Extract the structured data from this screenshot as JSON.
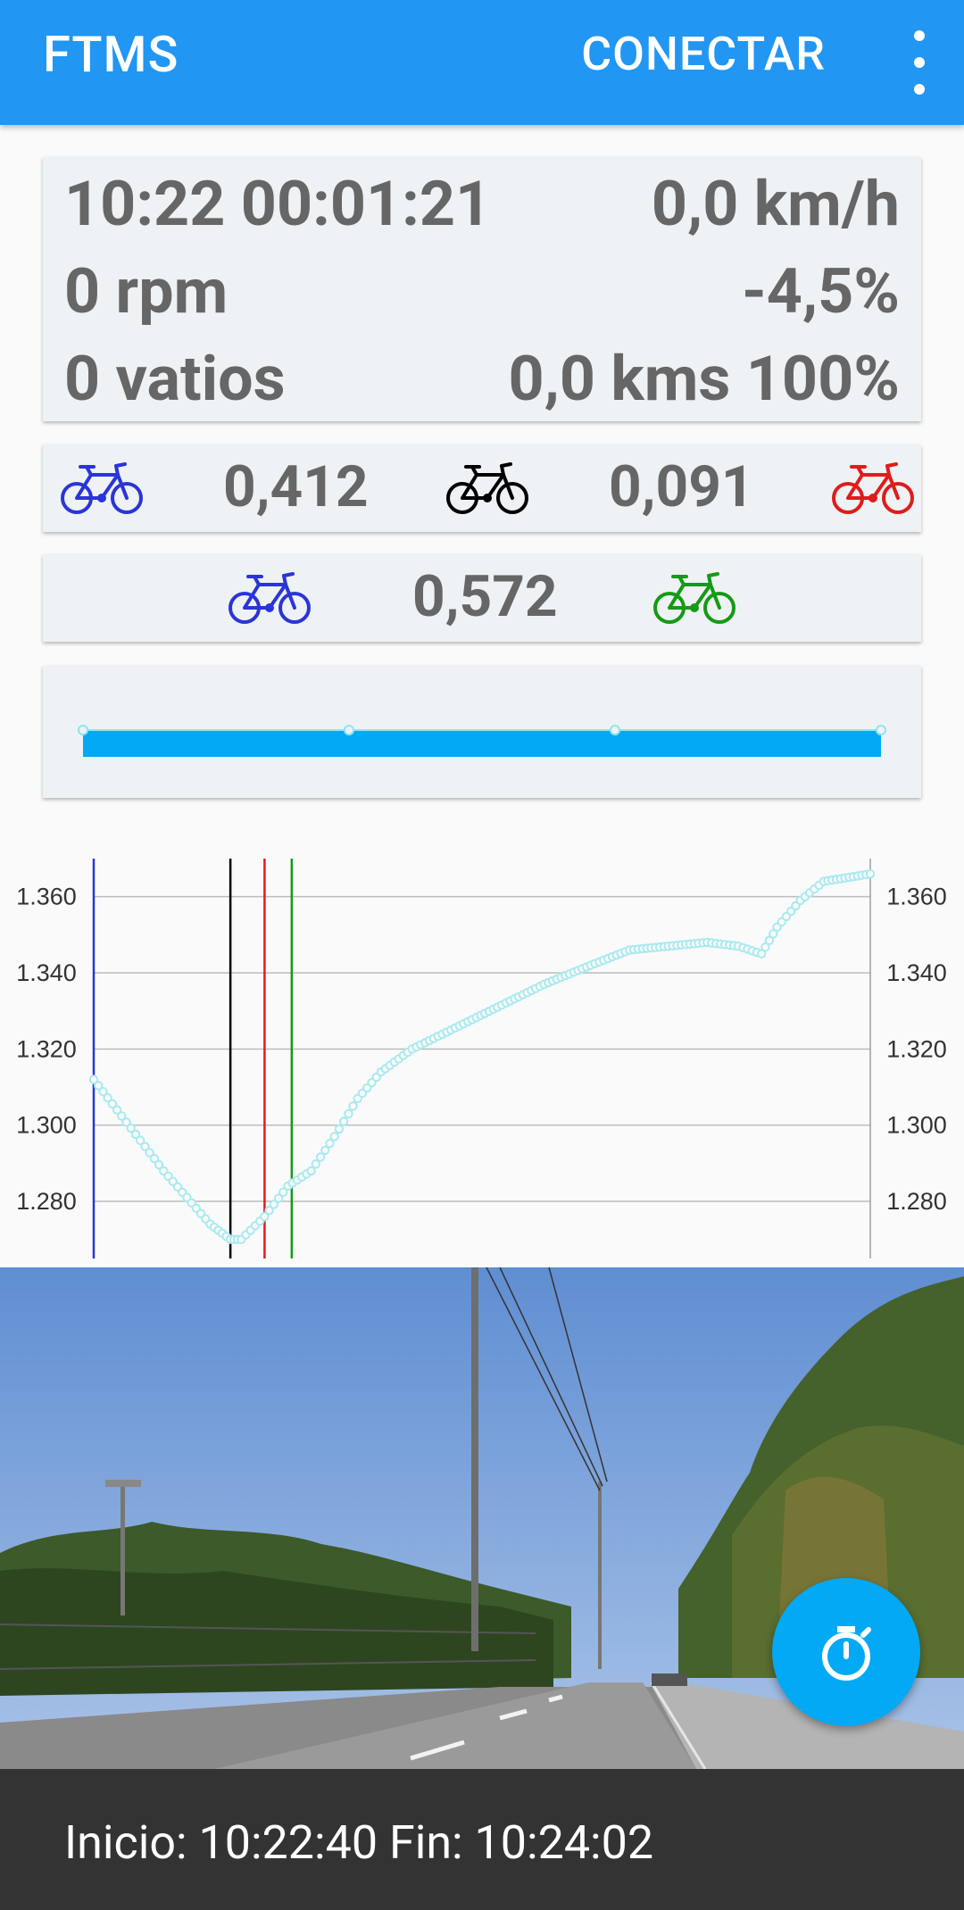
{
  "app_bar": {
    "title": "FTMS",
    "connect_label": "CONECTAR",
    "more_icon": "more-vert-icon"
  },
  "stats": {
    "clock": "10:22",
    "elapsed": "00:01:21",
    "speed": "0,0 km/h",
    "cadence": "0 rpm",
    "slope": "-4,5%",
    "power": "0 vatios",
    "distance_progress": "0,0 kms 100%"
  },
  "gaps_row1": {
    "left_bike_color": "#2a35d8",
    "value_a": "0,412",
    "middle_bike_color": "#000000",
    "value_b": "0,091",
    "right_bike_color": "#e11b1b"
  },
  "gaps_row2": {
    "left_bike_color": "#2a35d8",
    "value": "0,572",
    "right_bike_color": "#159a15"
  },
  "progress": {
    "bar_color": "#03a9f4",
    "fill_fraction": 1.0
  },
  "chart_data": {
    "type": "line",
    "yticks": [
      "1.360",
      "1.340",
      "1.320",
      "1.300",
      "1.280"
    ],
    "ylim": [
      1265,
      1370
    ],
    "x_range": [
      0,
      100
    ],
    "grid": true,
    "line_color": "#a8eaf0",
    "markers": [
      {
        "color": "#2a35d8",
        "x": 0
      },
      {
        "color": "#000000",
        "x": 17.6
      },
      {
        "color": "#e11b1b",
        "x": 22.0
      },
      {
        "color": "#159a15",
        "x": 25.5
      }
    ],
    "anchor_points": [
      [
        0,
        1312
      ],
      [
        3,
        1304
      ],
      [
        6,
        1296
      ],
      [
        9,
        1288
      ],
      [
        12,
        1281
      ],
      [
        15,
        1274
      ],
      [
        17.6,
        1270
      ],
      [
        19,
        1270
      ],
      [
        22,
        1276
      ],
      [
        25,
        1284
      ],
      [
        28,
        1288
      ],
      [
        31,
        1297
      ],
      [
        34,
        1307
      ],
      [
        37,
        1314
      ],
      [
        41,
        1320
      ],
      [
        46,
        1325
      ],
      [
        52,
        1331
      ],
      [
        58,
        1337
      ],
      [
        64,
        1342
      ],
      [
        69,
        1346
      ],
      [
        74,
        1347
      ],
      [
        79,
        1348
      ],
      [
        83,
        1347
      ],
      [
        86,
        1345
      ],
      [
        88,
        1352
      ],
      [
        91,
        1359
      ],
      [
        94,
        1364
      ],
      [
        100,
        1366
      ]
    ]
  },
  "video": {
    "fab_icon": "stopwatch-icon",
    "fab_color": "#03a9f4"
  },
  "footer": {
    "text": "Inicio: 10:22:40 Fin: 10:24:02"
  }
}
